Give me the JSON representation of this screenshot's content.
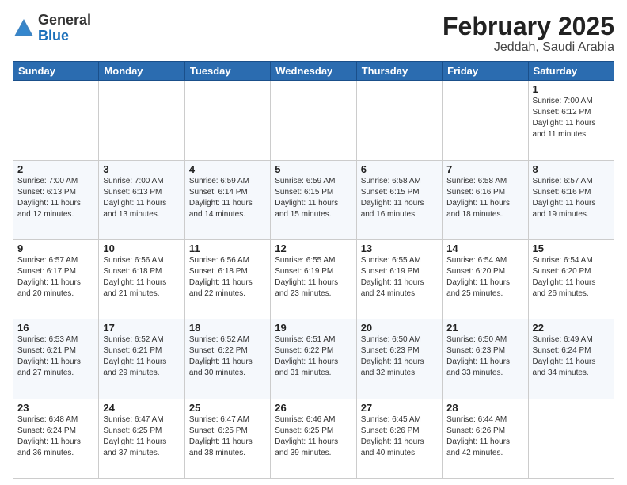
{
  "header": {
    "logo_general": "General",
    "logo_blue": "Blue",
    "month_title": "February 2025",
    "subtitle": "Jeddah, Saudi Arabia"
  },
  "weekdays": [
    "Sunday",
    "Monday",
    "Tuesday",
    "Wednesday",
    "Thursday",
    "Friday",
    "Saturday"
  ],
  "weeks": [
    [
      {
        "day": "",
        "info": ""
      },
      {
        "day": "",
        "info": ""
      },
      {
        "day": "",
        "info": ""
      },
      {
        "day": "",
        "info": ""
      },
      {
        "day": "",
        "info": ""
      },
      {
        "day": "",
        "info": ""
      },
      {
        "day": "1",
        "info": "Sunrise: 7:00 AM\nSunset: 6:12 PM\nDaylight: 11 hours\nand 11 minutes."
      }
    ],
    [
      {
        "day": "2",
        "info": "Sunrise: 7:00 AM\nSunset: 6:13 PM\nDaylight: 11 hours\nand 12 minutes."
      },
      {
        "day": "3",
        "info": "Sunrise: 7:00 AM\nSunset: 6:13 PM\nDaylight: 11 hours\nand 13 minutes."
      },
      {
        "day": "4",
        "info": "Sunrise: 6:59 AM\nSunset: 6:14 PM\nDaylight: 11 hours\nand 14 minutes."
      },
      {
        "day": "5",
        "info": "Sunrise: 6:59 AM\nSunset: 6:15 PM\nDaylight: 11 hours\nand 15 minutes."
      },
      {
        "day": "6",
        "info": "Sunrise: 6:58 AM\nSunset: 6:15 PM\nDaylight: 11 hours\nand 16 minutes."
      },
      {
        "day": "7",
        "info": "Sunrise: 6:58 AM\nSunset: 6:16 PM\nDaylight: 11 hours\nand 18 minutes."
      },
      {
        "day": "8",
        "info": "Sunrise: 6:57 AM\nSunset: 6:16 PM\nDaylight: 11 hours\nand 19 minutes."
      }
    ],
    [
      {
        "day": "9",
        "info": "Sunrise: 6:57 AM\nSunset: 6:17 PM\nDaylight: 11 hours\nand 20 minutes."
      },
      {
        "day": "10",
        "info": "Sunrise: 6:56 AM\nSunset: 6:18 PM\nDaylight: 11 hours\nand 21 minutes."
      },
      {
        "day": "11",
        "info": "Sunrise: 6:56 AM\nSunset: 6:18 PM\nDaylight: 11 hours\nand 22 minutes."
      },
      {
        "day": "12",
        "info": "Sunrise: 6:55 AM\nSunset: 6:19 PM\nDaylight: 11 hours\nand 23 minutes."
      },
      {
        "day": "13",
        "info": "Sunrise: 6:55 AM\nSunset: 6:19 PM\nDaylight: 11 hours\nand 24 minutes."
      },
      {
        "day": "14",
        "info": "Sunrise: 6:54 AM\nSunset: 6:20 PM\nDaylight: 11 hours\nand 25 minutes."
      },
      {
        "day": "15",
        "info": "Sunrise: 6:54 AM\nSunset: 6:20 PM\nDaylight: 11 hours\nand 26 minutes."
      }
    ],
    [
      {
        "day": "16",
        "info": "Sunrise: 6:53 AM\nSunset: 6:21 PM\nDaylight: 11 hours\nand 27 minutes."
      },
      {
        "day": "17",
        "info": "Sunrise: 6:52 AM\nSunset: 6:21 PM\nDaylight: 11 hours\nand 29 minutes."
      },
      {
        "day": "18",
        "info": "Sunrise: 6:52 AM\nSunset: 6:22 PM\nDaylight: 11 hours\nand 30 minutes."
      },
      {
        "day": "19",
        "info": "Sunrise: 6:51 AM\nSunset: 6:22 PM\nDaylight: 11 hours\nand 31 minutes."
      },
      {
        "day": "20",
        "info": "Sunrise: 6:50 AM\nSunset: 6:23 PM\nDaylight: 11 hours\nand 32 minutes."
      },
      {
        "day": "21",
        "info": "Sunrise: 6:50 AM\nSunset: 6:23 PM\nDaylight: 11 hours\nand 33 minutes."
      },
      {
        "day": "22",
        "info": "Sunrise: 6:49 AM\nSunset: 6:24 PM\nDaylight: 11 hours\nand 34 minutes."
      }
    ],
    [
      {
        "day": "23",
        "info": "Sunrise: 6:48 AM\nSunset: 6:24 PM\nDaylight: 11 hours\nand 36 minutes."
      },
      {
        "day": "24",
        "info": "Sunrise: 6:47 AM\nSunset: 6:25 PM\nDaylight: 11 hours\nand 37 minutes."
      },
      {
        "day": "25",
        "info": "Sunrise: 6:47 AM\nSunset: 6:25 PM\nDaylight: 11 hours\nand 38 minutes."
      },
      {
        "day": "26",
        "info": "Sunrise: 6:46 AM\nSunset: 6:25 PM\nDaylight: 11 hours\nand 39 minutes."
      },
      {
        "day": "27",
        "info": "Sunrise: 6:45 AM\nSunset: 6:26 PM\nDaylight: 11 hours\nand 40 minutes."
      },
      {
        "day": "28",
        "info": "Sunrise: 6:44 AM\nSunset: 6:26 PM\nDaylight: 11 hours\nand 42 minutes."
      },
      {
        "day": "",
        "info": ""
      }
    ]
  ]
}
